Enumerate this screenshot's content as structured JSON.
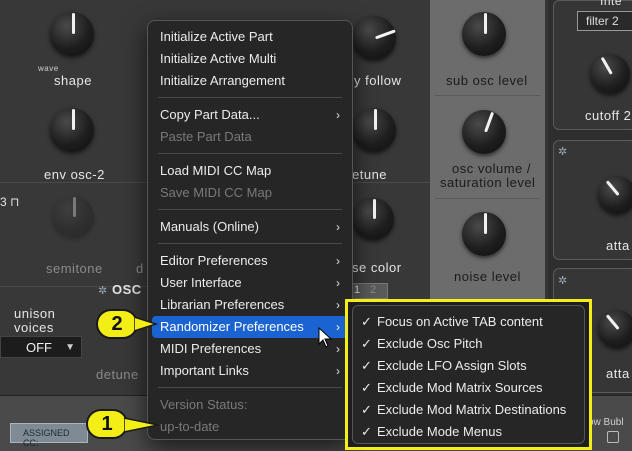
{
  "synth": {
    "knob_labels": {
      "shape": "shape",
      "env_osc2": "env osc-2",
      "semitone": "semitone",
      "detune": "detune",
      "key_follow": "y follow",
      "etune": "etune",
      "noise_color": "se color",
      "sub_osc_level": "sub osc level",
      "osc_volume_line1": "osc volume /",
      "osc_volume_line2": "saturation level",
      "noise_level": "noise level",
      "cutoff": "cutoff 2",
      "attack_a": "atta",
      "attack_b": "atta",
      "unison_line1": "unison",
      "unison_line2": "voices",
      "osc_header": "OSC",
      "wave": "wave",
      "lock_number": "3",
      "d_partial": "d"
    },
    "filter_select": "filter 2",
    "top_right_partial": "Inte",
    "unison_value": "OFF",
    "tabs": [
      "1",
      "2"
    ],
    "assigned_button": "ASSIGNED CC:",
    "bottom_right_partial": "ow Bubl"
  },
  "menu": {
    "items": [
      {
        "label": "Initialize Active Part",
        "disabled": false
      },
      {
        "label": "Initialize Active Multi",
        "disabled": false
      },
      {
        "label": "Initialize Arrangement",
        "disabled": false
      },
      {
        "sep": true
      },
      {
        "label": "Copy Part Data...",
        "disabled": false,
        "submenu": true
      },
      {
        "label": "Paste Part Data",
        "disabled": true
      },
      {
        "sep": true
      },
      {
        "label": "Load MIDI CC Map",
        "disabled": false
      },
      {
        "label": "Save MIDI CC Map",
        "disabled": true
      },
      {
        "sep": true
      },
      {
        "label": "Manuals (Online)",
        "disabled": false,
        "submenu": true
      },
      {
        "sep": true
      },
      {
        "label": "Editor Preferences",
        "disabled": false,
        "submenu": true
      },
      {
        "label": "User Interface",
        "disabled": false,
        "submenu": true
      },
      {
        "label": "Librarian Preferences",
        "disabled": false,
        "submenu": true
      },
      {
        "label": "Randomizer Preferences",
        "disabled": false,
        "submenu": true,
        "selected": true
      },
      {
        "label": "MIDI Preferences",
        "disabled": false,
        "submenu": true
      },
      {
        "label": "Important Links",
        "disabled": false,
        "submenu": true
      },
      {
        "sep": true
      },
      {
        "label": "Version Status:",
        "disabled": true
      },
      {
        "label": "up-to-date",
        "disabled": true
      }
    ],
    "arrow_glyph": "›"
  },
  "submenu": {
    "check_glyph": "✓",
    "items": [
      "Focus on Active TAB content",
      "Exclude Osc Pitch",
      "Exclude LFO Assign Slots",
      "Exclude Mod Matrix Sources",
      "Exclude Mod Matrix Destinations",
      "Exclude Mode Menus"
    ]
  },
  "callouts": [
    "1",
    "2"
  ],
  "colors": {
    "highlight": "#1a63d0",
    "callout": "#f3ee16"
  }
}
